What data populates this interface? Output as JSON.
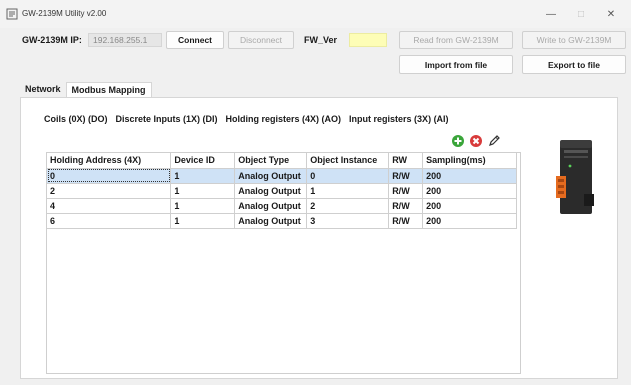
{
  "window": {
    "title": "GW-2139M Utility v2.00",
    "controls": {
      "minimize": "—",
      "maximize": "□",
      "close": "✕"
    }
  },
  "connection": {
    "ip_label": "GW-2139M IP:",
    "ip_value": "192.168.255.1",
    "connect_label": "Connect",
    "disconnect_label": "Disconnect",
    "fw_label": "FW_Ver",
    "fw_value": "",
    "read_label": "Read from GW-2139M",
    "write_label": "Write to GW-2139M",
    "import_label": "Import from file",
    "export_label": "Export to file"
  },
  "tabs": [
    {
      "label": "Network",
      "active": false
    },
    {
      "label": "Modbus Mapping",
      "active": true
    }
  ],
  "subtabs": [
    {
      "label": "Coils (0X) (DO)",
      "active": false
    },
    {
      "label": "Discrete Inputs (1X) (DI)",
      "active": false
    },
    {
      "label": "Holding registers (4X) (AO)",
      "active": true
    },
    {
      "label": "Input registers (3X) (AI)",
      "active": false
    }
  ],
  "toolbar": {
    "add_icon": "add-circle-icon",
    "delete_icon": "delete-circle-icon",
    "edit_icon": "edit-pencil-icon",
    "add_color": "#3aa53a",
    "delete_color": "#d83b3b"
  },
  "table": {
    "columns": [
      "Holding Address (4X)",
      "Device ID",
      "Object Type",
      "Object Instance",
      "RW",
      "Sampling(ms)"
    ],
    "rows": [
      [
        "0",
        "1",
        "Analog Output",
        "0",
        "R/W",
        "200"
      ],
      [
        "2",
        "1",
        "Analog Output",
        "1",
        "R/W",
        "200"
      ],
      [
        "4",
        "1",
        "Analog Output",
        "2",
        "R/W",
        "200"
      ],
      [
        "6",
        "1",
        "Analog Output",
        "3",
        "R/W",
        "200"
      ]
    ],
    "selected_row": 0
  },
  "colors": {
    "selection": "#cfe2f6",
    "fw_field": "#fdfdb6",
    "device_body": "#2b2b2b",
    "device_accent": "#e56b1f"
  }
}
